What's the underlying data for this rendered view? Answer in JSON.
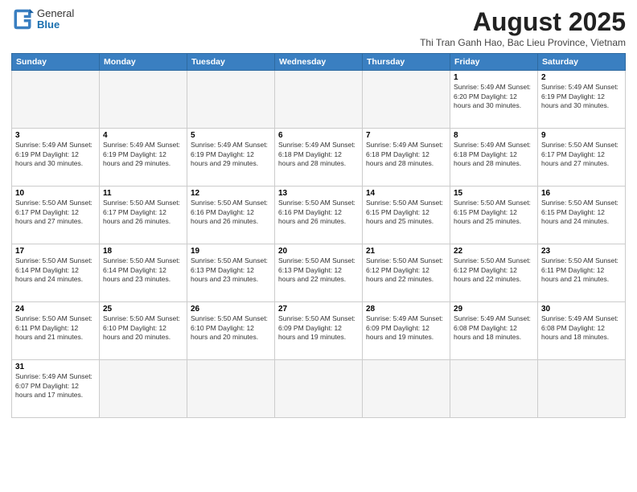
{
  "header": {
    "logo_general": "General",
    "logo_blue": "Blue",
    "month_year": "August 2025",
    "location": "Thi Tran Ganh Hao, Bac Lieu Province, Vietnam"
  },
  "days_of_week": [
    "Sunday",
    "Monday",
    "Tuesday",
    "Wednesday",
    "Thursday",
    "Friday",
    "Saturday"
  ],
  "weeks": [
    [
      {
        "day": "",
        "info": ""
      },
      {
        "day": "",
        "info": ""
      },
      {
        "day": "",
        "info": ""
      },
      {
        "day": "",
        "info": ""
      },
      {
        "day": "",
        "info": ""
      },
      {
        "day": "1",
        "info": "Sunrise: 5:49 AM\nSunset: 6:20 PM\nDaylight: 12 hours and 30 minutes."
      },
      {
        "day": "2",
        "info": "Sunrise: 5:49 AM\nSunset: 6:19 PM\nDaylight: 12 hours and 30 minutes."
      }
    ],
    [
      {
        "day": "3",
        "info": "Sunrise: 5:49 AM\nSunset: 6:19 PM\nDaylight: 12 hours and 30 minutes."
      },
      {
        "day": "4",
        "info": "Sunrise: 5:49 AM\nSunset: 6:19 PM\nDaylight: 12 hours and 29 minutes."
      },
      {
        "day": "5",
        "info": "Sunrise: 5:49 AM\nSunset: 6:19 PM\nDaylight: 12 hours and 29 minutes."
      },
      {
        "day": "6",
        "info": "Sunrise: 5:49 AM\nSunset: 6:18 PM\nDaylight: 12 hours and 28 minutes."
      },
      {
        "day": "7",
        "info": "Sunrise: 5:49 AM\nSunset: 6:18 PM\nDaylight: 12 hours and 28 minutes."
      },
      {
        "day": "8",
        "info": "Sunrise: 5:49 AM\nSunset: 6:18 PM\nDaylight: 12 hours and 28 minutes."
      },
      {
        "day": "9",
        "info": "Sunrise: 5:50 AM\nSunset: 6:17 PM\nDaylight: 12 hours and 27 minutes."
      }
    ],
    [
      {
        "day": "10",
        "info": "Sunrise: 5:50 AM\nSunset: 6:17 PM\nDaylight: 12 hours and 27 minutes."
      },
      {
        "day": "11",
        "info": "Sunrise: 5:50 AM\nSunset: 6:17 PM\nDaylight: 12 hours and 26 minutes."
      },
      {
        "day": "12",
        "info": "Sunrise: 5:50 AM\nSunset: 6:16 PM\nDaylight: 12 hours and 26 minutes."
      },
      {
        "day": "13",
        "info": "Sunrise: 5:50 AM\nSunset: 6:16 PM\nDaylight: 12 hours and 26 minutes."
      },
      {
        "day": "14",
        "info": "Sunrise: 5:50 AM\nSunset: 6:15 PM\nDaylight: 12 hours and 25 minutes."
      },
      {
        "day": "15",
        "info": "Sunrise: 5:50 AM\nSunset: 6:15 PM\nDaylight: 12 hours and 25 minutes."
      },
      {
        "day": "16",
        "info": "Sunrise: 5:50 AM\nSunset: 6:15 PM\nDaylight: 12 hours and 24 minutes."
      }
    ],
    [
      {
        "day": "17",
        "info": "Sunrise: 5:50 AM\nSunset: 6:14 PM\nDaylight: 12 hours and 24 minutes."
      },
      {
        "day": "18",
        "info": "Sunrise: 5:50 AM\nSunset: 6:14 PM\nDaylight: 12 hours and 23 minutes."
      },
      {
        "day": "19",
        "info": "Sunrise: 5:50 AM\nSunset: 6:13 PM\nDaylight: 12 hours and 23 minutes."
      },
      {
        "day": "20",
        "info": "Sunrise: 5:50 AM\nSunset: 6:13 PM\nDaylight: 12 hours and 22 minutes."
      },
      {
        "day": "21",
        "info": "Sunrise: 5:50 AM\nSunset: 6:12 PM\nDaylight: 12 hours and 22 minutes."
      },
      {
        "day": "22",
        "info": "Sunrise: 5:50 AM\nSunset: 6:12 PM\nDaylight: 12 hours and 22 minutes."
      },
      {
        "day": "23",
        "info": "Sunrise: 5:50 AM\nSunset: 6:11 PM\nDaylight: 12 hours and 21 minutes."
      }
    ],
    [
      {
        "day": "24",
        "info": "Sunrise: 5:50 AM\nSunset: 6:11 PM\nDaylight: 12 hours and 21 minutes."
      },
      {
        "day": "25",
        "info": "Sunrise: 5:50 AM\nSunset: 6:10 PM\nDaylight: 12 hours and 20 minutes."
      },
      {
        "day": "26",
        "info": "Sunrise: 5:50 AM\nSunset: 6:10 PM\nDaylight: 12 hours and 20 minutes."
      },
      {
        "day": "27",
        "info": "Sunrise: 5:50 AM\nSunset: 6:09 PM\nDaylight: 12 hours and 19 minutes."
      },
      {
        "day": "28",
        "info": "Sunrise: 5:49 AM\nSunset: 6:09 PM\nDaylight: 12 hours and 19 minutes."
      },
      {
        "day": "29",
        "info": "Sunrise: 5:49 AM\nSunset: 6:08 PM\nDaylight: 12 hours and 18 minutes."
      },
      {
        "day": "30",
        "info": "Sunrise: 5:49 AM\nSunset: 6:08 PM\nDaylight: 12 hours and 18 minutes."
      }
    ],
    [
      {
        "day": "31",
        "info": "Sunrise: 5:49 AM\nSunset: 6:07 PM\nDaylight: 12 hours and 17 minutes."
      },
      {
        "day": "",
        "info": ""
      },
      {
        "day": "",
        "info": ""
      },
      {
        "day": "",
        "info": ""
      },
      {
        "day": "",
        "info": ""
      },
      {
        "day": "",
        "info": ""
      },
      {
        "day": "",
        "info": ""
      }
    ]
  ]
}
